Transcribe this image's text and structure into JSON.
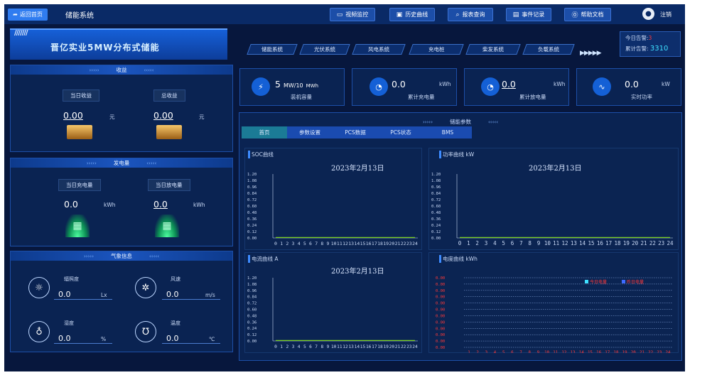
{
  "topbar": {
    "back_label": "返回首页",
    "system_title": "储能系统",
    "buttons": [
      {
        "label": "视频监控",
        "icon": "video-icon"
      },
      {
        "label": "历史曲线",
        "icon": "chart-icon"
      },
      {
        "label": "报表查询",
        "icon": "search-icon"
      },
      {
        "label": "事件记录",
        "icon": "document-icon"
      },
      {
        "label": "帮助文档",
        "icon": "help-icon"
      }
    ],
    "logout_label": "注销"
  },
  "header": {
    "company_title": "晋亿实业5MW分布式储能",
    "nav_tabs": [
      "储能系统",
      "光伏系统",
      "风电系统",
      "充电桩",
      "柴发系统",
      "负载系统"
    ],
    "alarm_today_label": "今日告警:",
    "alarm_today_value": "3",
    "alarm_total_label": "累计告警:",
    "alarm_total_value": "3310"
  },
  "income": {
    "title": "收益",
    "today_label": "当日收益",
    "today_value": "0.00",
    "total_label": "总收益",
    "total_value": "0.00",
    "unit": "元"
  },
  "generation": {
    "title": "发电量",
    "charge_label": "当日充电量",
    "charge_value": "0.0",
    "discharge_label": "当日放电量",
    "discharge_value": "0.0",
    "unit": "kWh"
  },
  "weather": {
    "title": "气象信息",
    "items": [
      {
        "label": "辐照度",
        "value": "0.0",
        "unit": "Lx",
        "icon": "sun-icon"
      },
      {
        "label": "风速",
        "value": "0.0",
        "unit": "m/s",
        "icon": "fan-icon"
      },
      {
        "label": "湿度",
        "value": "0.0",
        "unit": "%",
        "icon": "humidity-icon"
      },
      {
        "label": "温度",
        "value": "0.0",
        "unit": "℃",
        "icon": "temperature-icon"
      }
    ]
  },
  "stats": [
    {
      "icon": "battery-icon",
      "value": "5",
      "value_unit": "MW/10",
      "value_unit2": "MWh",
      "label": "装机容量"
    },
    {
      "icon": "gauge-icon",
      "value": "0.0",
      "unit": "kWh",
      "label": "累计充电量"
    },
    {
      "icon": "gauge-icon",
      "value": "0.0",
      "unit": "kWh",
      "label": "累计放电量"
    },
    {
      "icon": "pulse-icon",
      "value": "0.0",
      "unit": "kW",
      "label": "实时功率"
    }
  ],
  "params": {
    "title": "储能参数",
    "tabs": [
      "首页",
      "参数设置",
      "PCS数据",
      "PCS状态",
      "BMS"
    ],
    "active_tab": "首页"
  },
  "charts_meta": {
    "date": "2023年2月13日"
  },
  "chart_data": [
    {
      "type": "line",
      "title": "SOC曲线",
      "subtitle": "2023年2月13日",
      "categories": [
        "0",
        "1",
        "2",
        "3",
        "4",
        "5",
        "6",
        "7",
        "8",
        "9",
        "10",
        "11",
        "12",
        "13",
        "14",
        "15",
        "16",
        "17",
        "18",
        "19",
        "20",
        "21",
        "22",
        "23",
        "24"
      ],
      "series": [
        {
          "values": [
            0,
            0,
            0,
            0,
            0,
            0,
            0,
            0,
            0,
            0,
            0,
            0,
            0,
            0,
            0,
            0,
            0,
            0,
            0,
            0,
            0,
            0,
            0,
            0,
            0
          ],
          "color": "#7ed321"
        }
      ],
      "yticks": [
        "1.20",
        "1.08",
        "0.96",
        "0.84",
        "0.72",
        "0.60",
        "0.48",
        "0.36",
        "0.24",
        "0.12",
        "0.00"
      ],
      "ylim": [
        0,
        1.2
      ]
    },
    {
      "type": "line",
      "title": "功率曲线 kW",
      "subtitle": "2023年2月13日",
      "categories": [
        "0",
        "1",
        "2",
        "3",
        "4",
        "5",
        "6",
        "7",
        "8",
        "9",
        "10",
        "11",
        "12",
        "13",
        "14",
        "15",
        "16",
        "17",
        "18",
        "19",
        "20",
        "21",
        "22",
        "23",
        "24"
      ],
      "series": [
        {
          "values": [
            0,
            0,
            0,
            0,
            0,
            0,
            0,
            0,
            0,
            0,
            0,
            0,
            0,
            0,
            0,
            0,
            0,
            0,
            0,
            0,
            0,
            0,
            0,
            0,
            0
          ],
          "color": "#7ed321"
        }
      ],
      "yticks": [
        "1.20",
        "1.08",
        "0.96",
        "0.84",
        "0.72",
        "0.60",
        "0.48",
        "0.36",
        "0.24",
        "0.12",
        "0.00"
      ],
      "ylim": [
        0,
        1.2
      ]
    },
    {
      "type": "line",
      "title": "电流曲线 A",
      "subtitle": "2023年2月13日",
      "categories": [
        "0",
        "1",
        "2",
        "3",
        "4",
        "5",
        "6",
        "7",
        "8",
        "9",
        "10",
        "11",
        "12",
        "13",
        "14",
        "15",
        "16",
        "17",
        "18",
        "19",
        "20",
        "21",
        "22",
        "23",
        "24"
      ],
      "series": [
        {
          "values": [
            0,
            0,
            0,
            0,
            0,
            0,
            0,
            0,
            0,
            0,
            0,
            0,
            0,
            0,
            0,
            0,
            0,
            0,
            0,
            0,
            0,
            0,
            0,
            0,
            0
          ],
          "color": "#7ed321"
        }
      ],
      "yticks": [
        "1.20",
        "1.08",
        "0.96",
        "0.84",
        "0.72",
        "0.60",
        "0.48",
        "0.36",
        "0.24",
        "0.12",
        "0.00"
      ],
      "ylim": [
        0,
        1.2
      ]
    },
    {
      "type": "bar",
      "title": "电度曲线 kWh",
      "categories": [
        "1",
        "2",
        "3",
        "4",
        "5",
        "6",
        "7",
        "8",
        "9",
        "10",
        "11",
        "12",
        "13",
        "14",
        "15",
        "16",
        "17",
        "18",
        "19",
        "20",
        "21",
        "22",
        "23",
        "24"
      ],
      "series": [
        {
          "name": "今日电量",
          "color": "#3ee0ff",
          "values": [
            0,
            0,
            0,
            0,
            0,
            0,
            0,
            0,
            0,
            0,
            0,
            0,
            0,
            0,
            0,
            0,
            0,
            0,
            0,
            0,
            0,
            0,
            0,
            0
          ]
        },
        {
          "name": "昨日电量",
          "color": "#3d6bff",
          "values": [
            0,
            0,
            0,
            0,
            0,
            0,
            0,
            0,
            0,
            0,
            0,
            0,
            0,
            0,
            0,
            0,
            0,
            0,
            0,
            0,
            0,
            0,
            0,
            0
          ]
        }
      ],
      "yticks": [
        "0.00",
        "0.00",
        "0.00",
        "0.00",
        "0.00",
        "0.00",
        "0.00",
        "0.00",
        "0.00",
        "0.00",
        "0.00",
        "0.00"
      ],
      "legend": "top-right",
      "grid": true
    }
  ]
}
